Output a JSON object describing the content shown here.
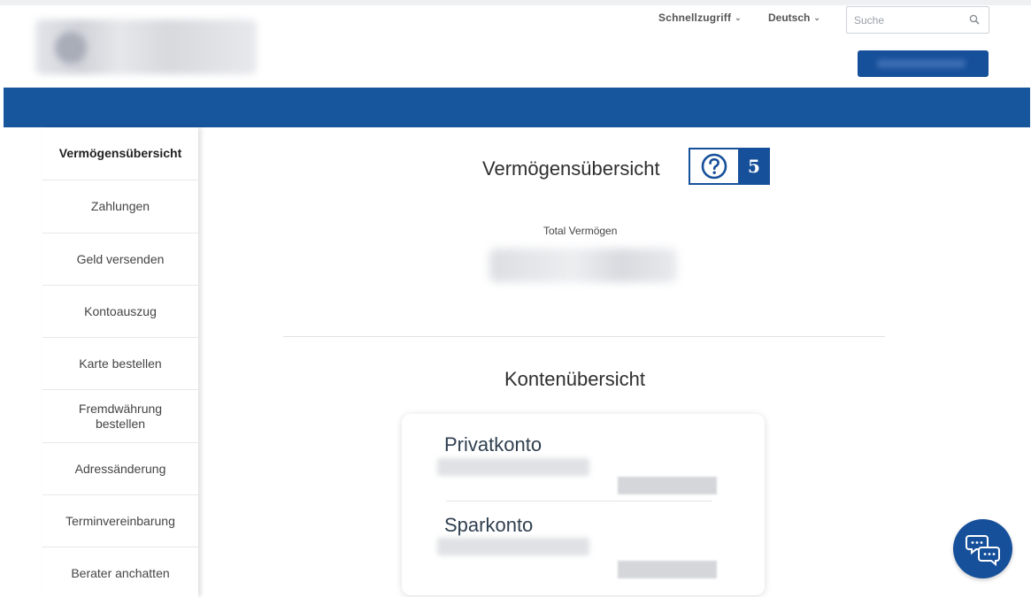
{
  "header": {
    "quick_access_label": "Schnellzugriff",
    "language_label": "Deutsch",
    "search_placeholder": "Suche"
  },
  "sidebar": {
    "items": [
      {
        "label": "Vermögensübersicht",
        "active": true
      },
      {
        "label": "Zahlungen"
      },
      {
        "label": "Geld versenden"
      },
      {
        "label": "Kontoauszug"
      },
      {
        "label": "Karte bestellen"
      },
      {
        "label": "Fremdwährung bestellen"
      },
      {
        "label": "Adressänderung"
      },
      {
        "label": "Terminvereinbarung"
      },
      {
        "label": "Berater anchatten"
      }
    ]
  },
  "main": {
    "title": "Vermögensübersicht",
    "help_icon": "question-circle-icon",
    "annotation_number": "5",
    "total_label": "Total Vermögen",
    "accounts_title": "Kontenübersicht",
    "accounts": [
      {
        "name": "Privatkonto"
      },
      {
        "name": "Sparkonto"
      }
    ]
  },
  "chat": {
    "icon": "chat-bubbles-icon"
  },
  "colors": {
    "brand_blue": "#17569d",
    "button_blue": "#17509a",
    "text": "#2f2f2f"
  }
}
